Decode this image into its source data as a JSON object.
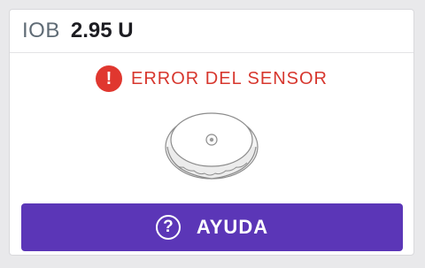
{
  "iob": {
    "label": "IOB",
    "value": "2.95 U"
  },
  "status": {
    "error_icon_glyph": "!",
    "error_text": "ERROR DEL SENSOR",
    "color": "#d7372e"
  },
  "sensor": {
    "icon_name": "sensor-device-icon"
  },
  "help": {
    "icon_glyph": "?",
    "label": "AYUDA",
    "color": "#5b36b7"
  }
}
